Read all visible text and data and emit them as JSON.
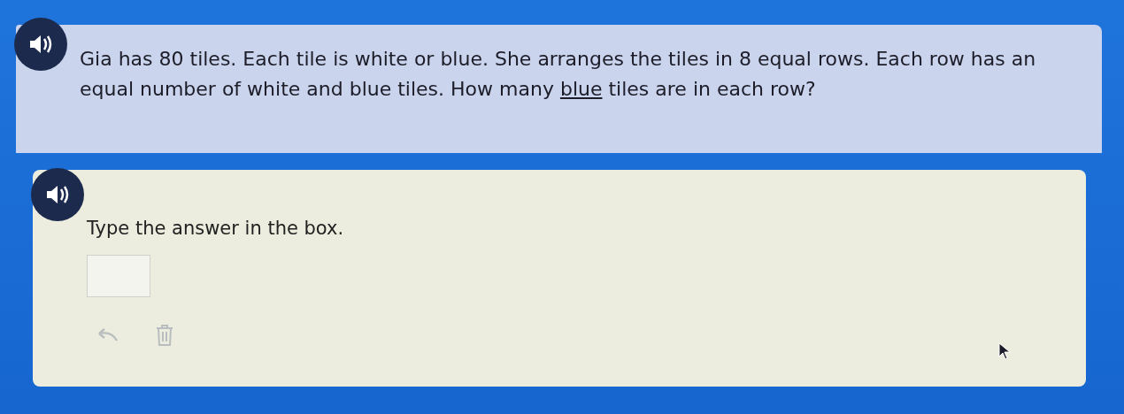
{
  "question": {
    "segments": [
      {
        "text": "Gia has 80 tiles. Each tile is white or blue. She arranges the tiles in 8 equal rows. Each row has an equal number of white and blue tiles. How many ",
        "underlined": false
      },
      {
        "text": "blue",
        "underlined": true
      },
      {
        "text": " tiles are in each row?",
        "underlined": false
      }
    ]
  },
  "answer_section": {
    "prompt": "Type the answer in the box.",
    "tools": [
      {
        "kind": "undo",
        "disabled": true
      },
      {
        "kind": "delete",
        "disabled": true
      }
    ]
  }
}
